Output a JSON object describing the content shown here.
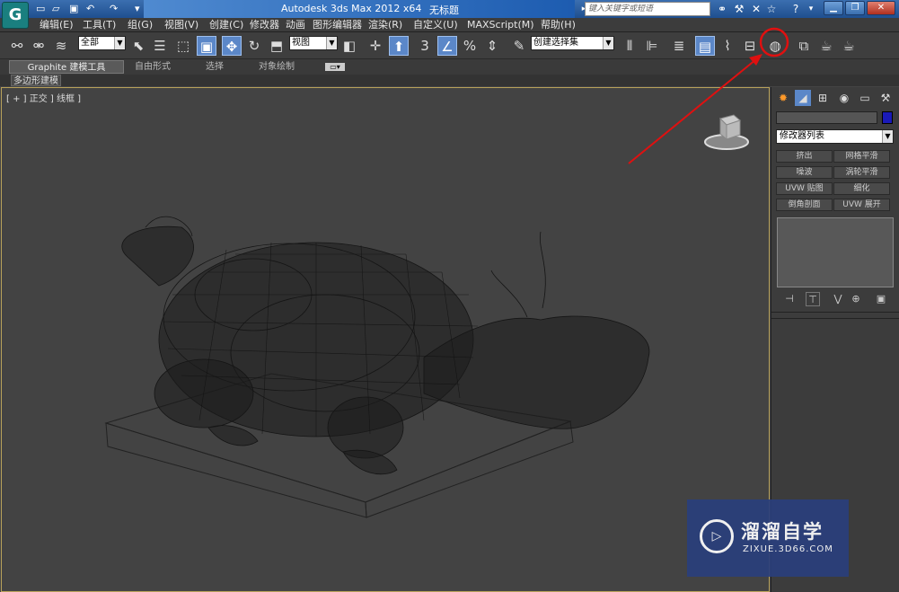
{
  "title_bar": {
    "app_title": "Autodesk 3ds Max  2012 x64",
    "doc_title": "无标题",
    "search_placeholder": "键入关键字或短语",
    "logo_glyph": "G"
  },
  "menu": {
    "items": [
      "编辑(E)",
      "工具(T)",
      "组(G)",
      "视图(V)",
      "创建(C)",
      "修改器",
      "动画",
      "图形编辑器",
      "渲染(R)",
      "自定义(U)",
      "MAXScript(M)",
      "帮助(H)"
    ]
  },
  "toolbar": {
    "selection_filter": "全部",
    "ref_coord": "视图",
    "named_selection": "创建选择集",
    "snap_label": "3",
    "percent_label": "%"
  },
  "ribbon": {
    "tabs": [
      "Graphite 建模工具",
      "自由形式",
      "选择",
      "对象绘制"
    ],
    "sub_label": "多边形建模"
  },
  "viewport": {
    "label": "[ + ] 正交 ] 线框 ]"
  },
  "command_panel": {
    "modifier_list": "修改器列表",
    "modifier_buttons": [
      "挤出",
      "网格平滑",
      "噪波",
      "涡轮平滑",
      "UVW 贴图",
      "细化",
      "倒角剖面",
      "UVW 展开"
    ],
    "object_color": "#1a1ab8"
  },
  "watermark": {
    "logo_glyph": "▷",
    "title": "溜溜自学",
    "subtitle": "ZIXUE.3D66.COM"
  },
  "annotation": {
    "color": "#e01010"
  }
}
